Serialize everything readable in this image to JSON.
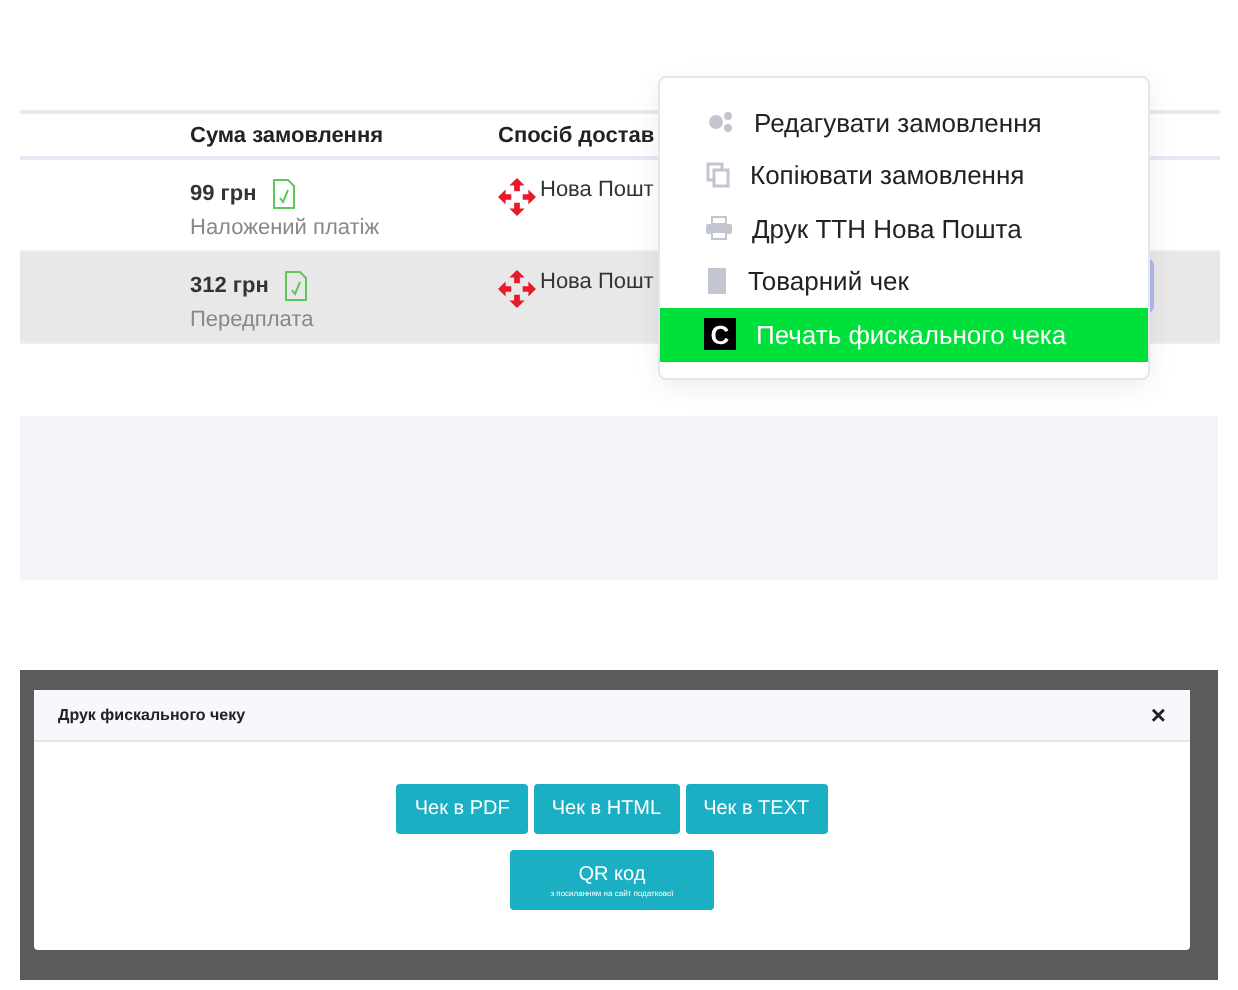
{
  "table": {
    "columns": [
      "Сума замовлення",
      "Спосіб достав"
    ],
    "rows": [
      {
        "amount": "99 грн",
        "payment": "Наложений платіж",
        "delivery": "Нова Пошт",
        "selected": false
      },
      {
        "amount": "312 грн",
        "payment": "Передплата",
        "delivery": "Нова Пошт",
        "selected": true
      }
    ]
  },
  "menu": {
    "items": [
      {
        "kind": "gears",
        "label": "Редагувати замовлення",
        "selected": false
      },
      {
        "kind": "copy",
        "label": "Копіювати замовлення",
        "selected": false
      },
      {
        "kind": "print",
        "label": "Друк ТТН Нова Пошта",
        "selected": false
      },
      {
        "kind": "receipt",
        "label": "Товарний чек",
        "selected": false
      },
      {
        "kind": "badge",
        "label": "Печать фискального чека",
        "badge": "C",
        "selected": true
      }
    ]
  },
  "dialog": {
    "title": "Друк фискального чеку",
    "close": "×",
    "buttons": [
      {
        "label": "Чек в PDF"
      },
      {
        "label": "Чек в HTML"
      },
      {
        "label": "Чек в TEXT"
      }
    ],
    "qr_button": {
      "label": "QR код",
      "note": "з посиланням на сайт податкової"
    }
  }
}
